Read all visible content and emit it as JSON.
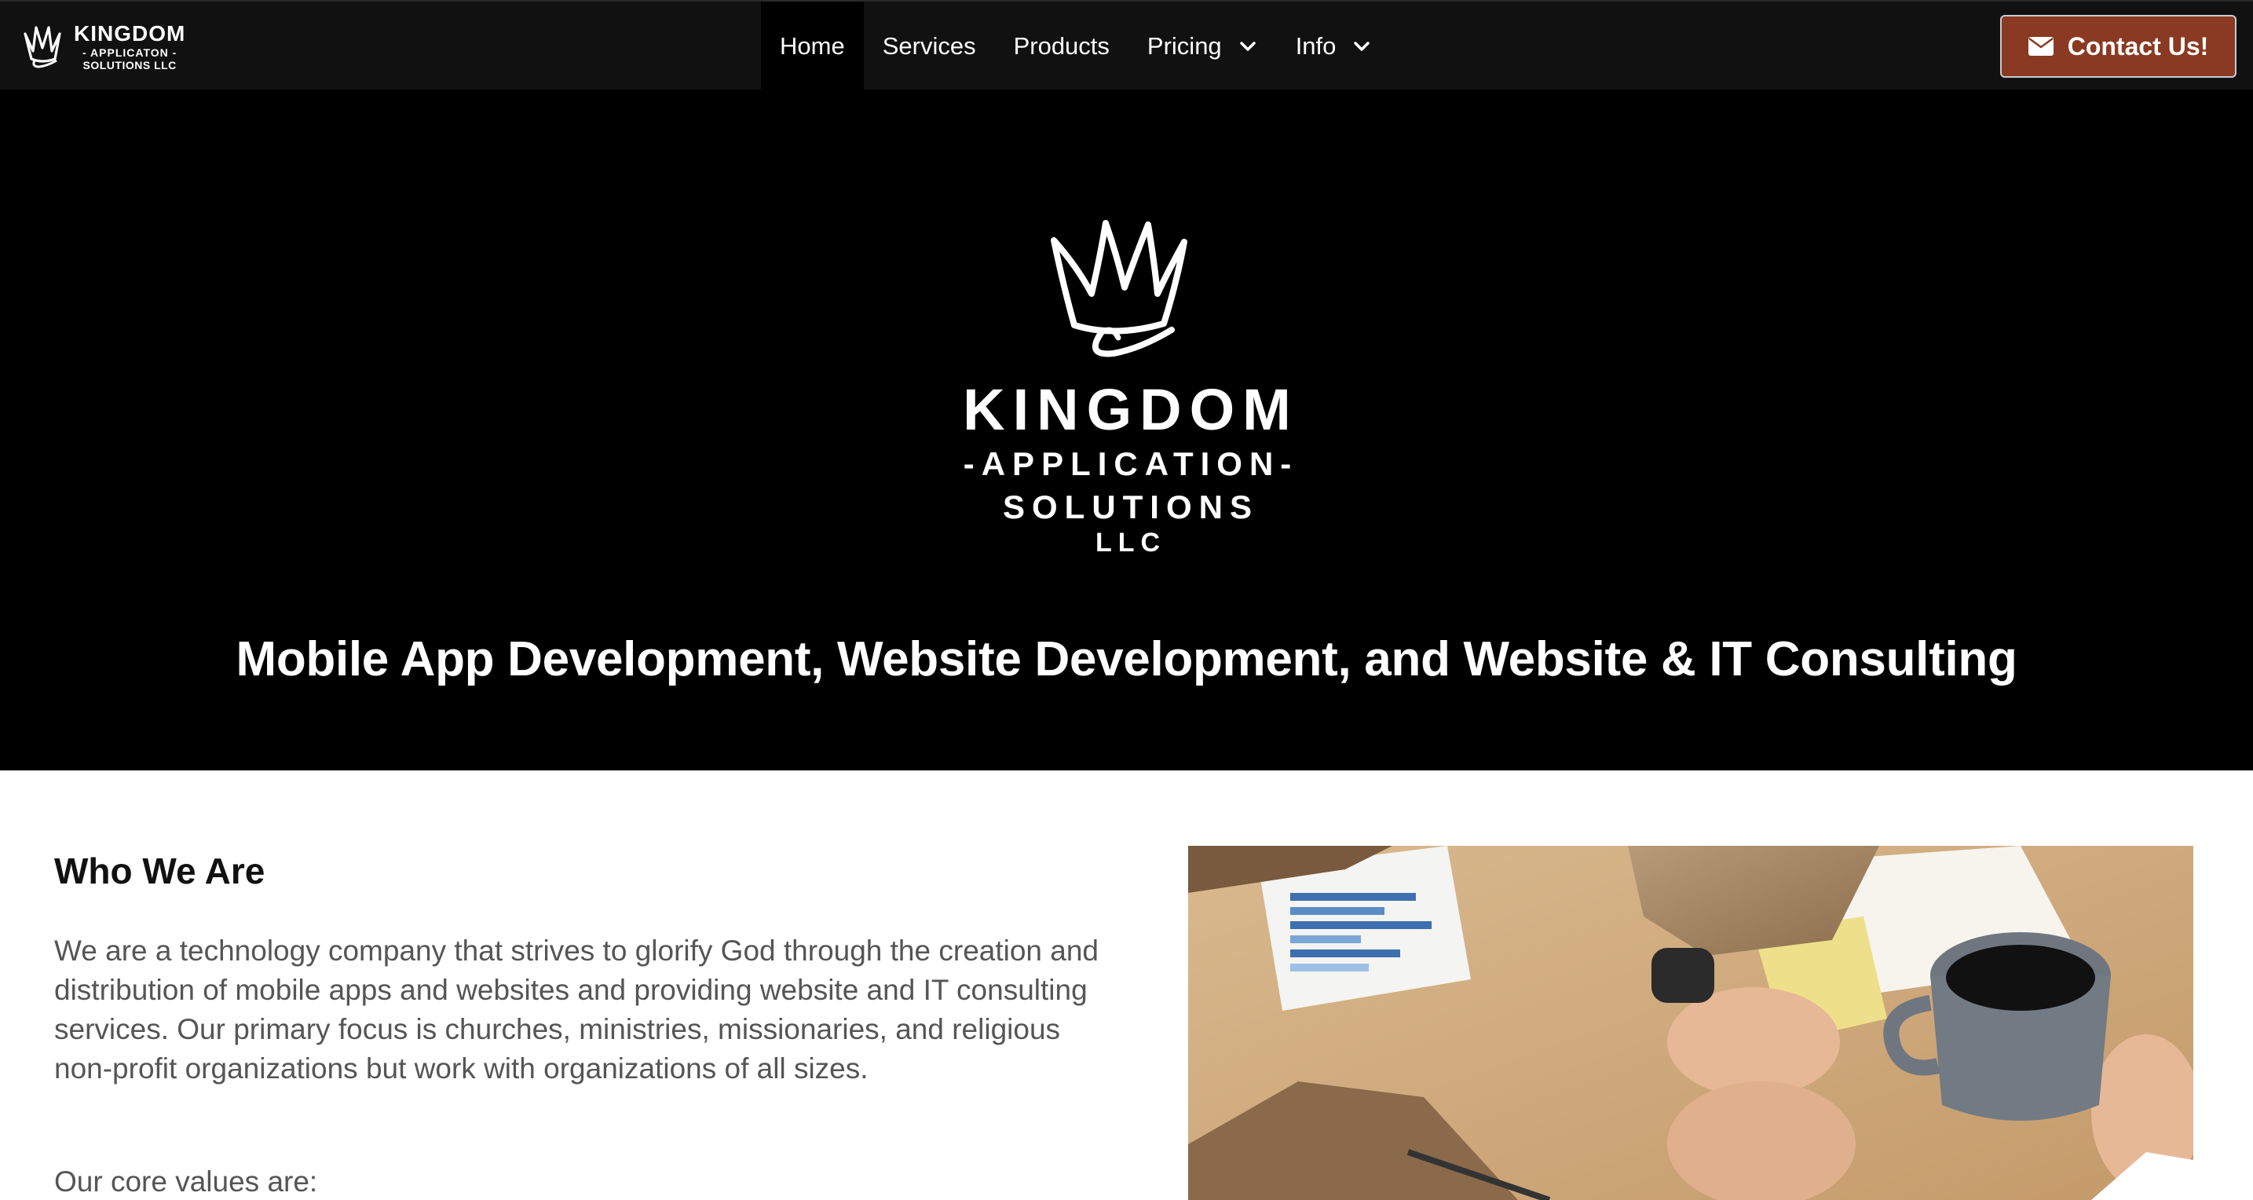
{
  "navbar": {
    "brand": {
      "line1": "KINGDOM",
      "line2": "- APPLICATON -",
      "line3": "SOLUTIONS LLC"
    },
    "items": [
      {
        "label": "Home",
        "active": true
      },
      {
        "label": "Services"
      },
      {
        "label": "Products"
      },
      {
        "label": "Pricing",
        "dropdown": true
      },
      {
        "label": "Info",
        "dropdown": true
      }
    ],
    "contact_label": "Contact Us!"
  },
  "hero": {
    "logo": {
      "line1": "KINGDOM",
      "line2": "-APPLICATION-",
      "line3": "SOLUTIONS",
      "line4": "LLC"
    },
    "tagline": "Mobile App Development, Website Development, and Website & IT Consulting"
  },
  "about": {
    "title": "Who We Are",
    "body": "We are a technology company that strives to glorify God through the creation and distribution of mobile apps and websites and providing website and IT consulting services. Our primary focus is churches, ministries, missionaries, and religious non-profit organizations but work with organizations of all sizes.",
    "values_intro": "Our core values are:"
  },
  "colors": {
    "navbar_bg": "#111111",
    "hero_bg": "#000000",
    "contact_button": "#8a3a22",
    "body_text": "#555555"
  },
  "icons": {
    "brand": "crown-icon",
    "dropdown": "chevron-down-icon",
    "contact": "envelope-icon"
  }
}
